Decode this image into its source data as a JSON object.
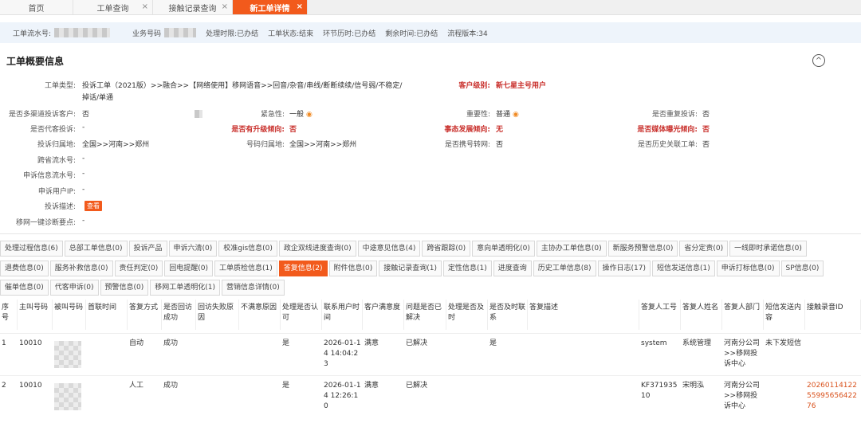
{
  "tabs": [
    {
      "label": "首页",
      "closable": false
    },
    {
      "label": "工单查询",
      "closable": true
    },
    {
      "label": "接触记录查询",
      "closable": true
    },
    {
      "label": "新工单详情",
      "closable": true,
      "active": true
    }
  ],
  "strip": {
    "serial_label": "工单流水号:",
    "business_label": "业务号码",
    "deadline": "处理时限:已办结",
    "status": "工单状态:结束",
    "link_time": "环节历时:已办结",
    "remain": "剩余时间:已办结",
    "version": "流程版本:34"
  },
  "overview": {
    "title": "工单概要信息",
    "type_label": "工单类型:",
    "type_value_1": "投诉工单（2021版）>>融合>>【网络使用】移网语音>>回音/杂音/串线/断断续续/信号弱/不稳定/",
    "type_value_2": "掉话/单通",
    "customer_level_label": "客户级别:",
    "customer_level_value": "新七星主号用户",
    "fields": {
      "multi_channel_label": "是否多渠道投诉客户:",
      "multi_channel_value": "否",
      "urgency_label": "紧急性:",
      "urgency_value": "一般",
      "importance_label": "重要性:",
      "importance_value": "普通",
      "repeat_label": "是否重复投诉:",
      "repeat_value": "否",
      "proxy_label": "是否代客投诉:",
      "proxy_value": "-",
      "upgrade_label": "是否有升级倾向:",
      "upgrade_value": "否",
      "escalation_label": "事态发展倾向:",
      "escalation_value": "无",
      "media_label": "是否媒体曝光倾向:",
      "media_value": "否",
      "belong_label": "投诉归属地:",
      "belong_value": "全国>>河南>>郑州",
      "number_belong_label": "号码归属地:",
      "number_belong_value": "全国>>河南>>郑州",
      "portability_label": "是否携号转网:",
      "portability_value": "否",
      "history_label": "是否历史关联工单:",
      "history_value": "否",
      "cross_province_label": "跨省流水号:",
      "cross_province_value": "-",
      "appeal_serial_label": "申诉信息流水号:",
      "appeal_serial_value": "-",
      "appeal_ip_label": "申诉用户IP:",
      "appeal_ip_value": "-",
      "desc_label": "投诉描述:",
      "desc_button": "查看",
      "diagnosis_label": "移网一键诊断要点:",
      "diagnosis_value": "-"
    }
  },
  "subtabs_row1": [
    "处理过程信息(6)",
    "总部工单信息(0)",
    "投诉产品",
    "申诉六清(0)",
    "校准gis信息(0)",
    "政企双线进度查询(0)",
    "中途意见信息(4)",
    "跨省跟踪(0)",
    "意向单透明化(0)",
    "主协办工单信息(0)",
    "新服务预警信息(0)",
    "省分定责(0)",
    "一线即时承诺信息(0)"
  ],
  "subtabs_row2": [
    "退费信息(0)",
    "服务补救信息(0)",
    "责任判定(0)",
    "回电提醒(0)",
    "工单质检信息(1)",
    "答复信息(2)",
    "附件信息(0)",
    "接触记录查询(1)",
    "定性信息(1)",
    "进度查询",
    "历史工单信息(8)",
    "操作日志(17)",
    "短信发送信息(1)",
    "申诉打标信息(0)",
    "SP信息(0)"
  ],
  "subtabs_row3": [
    "催单信息(0)",
    "代客申诉(0)",
    "预警信息(0)",
    "移网工单透明化(1)",
    "营销信息详情(0)"
  ],
  "active_subtab": "答复信息(2)",
  "table": {
    "headers": [
      "序号",
      "主叫号码",
      "被叫号码",
      "首联时间",
      "答复方式",
      "是否回访成功",
      "回访失败原因",
      "不满意原因",
      "处理是否认可",
      "联系用户时间",
      "客户满意度",
      "问题是否已解决",
      "处理是否及时",
      "是否及时联系",
      "答复描述",
      "答复人工号",
      "答复人姓名",
      "答复人部门",
      "短信发送内容",
      "接触录音ID"
    ],
    "rows": [
      {
        "no": "1",
        "caller": "10010",
        "first_contact": "",
        "method": "自动",
        "revisit": "成功",
        "fail_reason": "",
        "unsatisfied": "",
        "accepted": "是",
        "contact_time": "2026-01-14 14:04:23",
        "satisfaction": "满意",
        "solved": "已解决",
        "timely": "",
        "contact_timely": "是",
        "desc": "",
        "staff_no": "system",
        "staff_name": "系统管理",
        "dept": "河南分公司>>移网投诉中心",
        "sms": "未下发短信",
        "record_id": ""
      },
      {
        "no": "2",
        "caller": "10010",
        "first_contact": "",
        "method": "人工",
        "revisit": "成功",
        "fail_reason": "",
        "unsatisfied": "",
        "accepted": "是",
        "contact_time": "2026-01-14 12:26:10",
        "satisfaction": "满意",
        "solved": "已解决",
        "timely": "",
        "contact_timely": "",
        "desc": "",
        "staff_no": "KF37193510",
        "staff_name": "宋明泓",
        "dept": "河南分公司>>移网投诉中心",
        "sms": "",
        "record_id": "202601141225599565642276"
      }
    ]
  }
}
